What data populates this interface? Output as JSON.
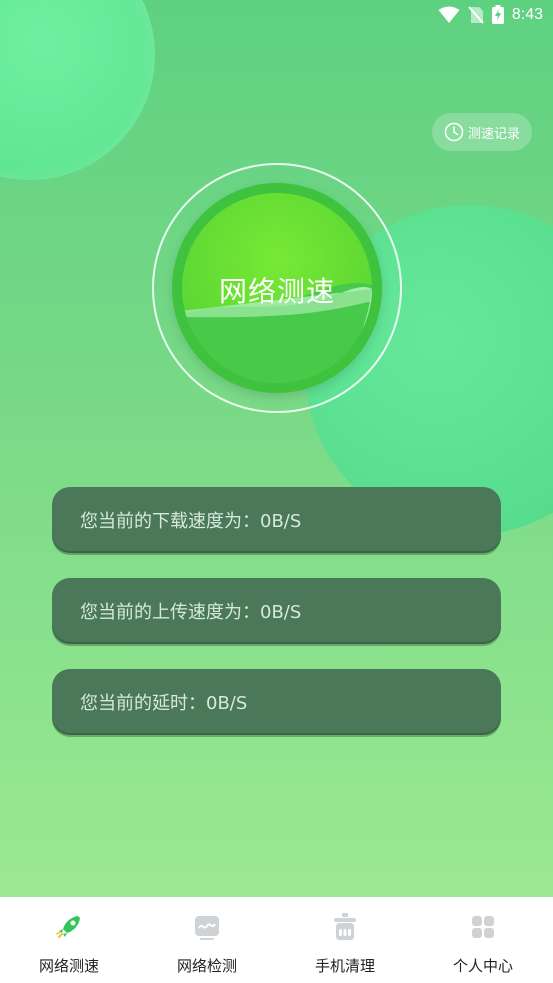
{
  "status_bar": {
    "time": "8:43",
    "icons": [
      "wifi-icon",
      "no-sim-icon",
      "battery-charging-icon"
    ]
  },
  "header": {
    "history_label": "测速记录",
    "history_icon": "clock-icon"
  },
  "speed_test": {
    "button_label": "网络测速"
  },
  "results": {
    "download": "您当前的下载速度为：0B/S",
    "upload": "您当前的上传速度为：0B/S",
    "latency": "您当前的延时：0B/S"
  },
  "tabs": [
    {
      "label": "网络测速",
      "icon": "rocket-icon",
      "active": true
    },
    {
      "label": "网络检测",
      "icon": "network-check-icon",
      "active": false
    },
    {
      "label": "手机清理",
      "icon": "cleaner-icon",
      "active": false
    },
    {
      "label": "个人中心",
      "icon": "grid-icon",
      "active": false
    }
  ],
  "colors": {
    "accent_green": "#3fc23e",
    "card_bg": "#4a7858",
    "inactive_icon": "#cfd3d6"
  }
}
